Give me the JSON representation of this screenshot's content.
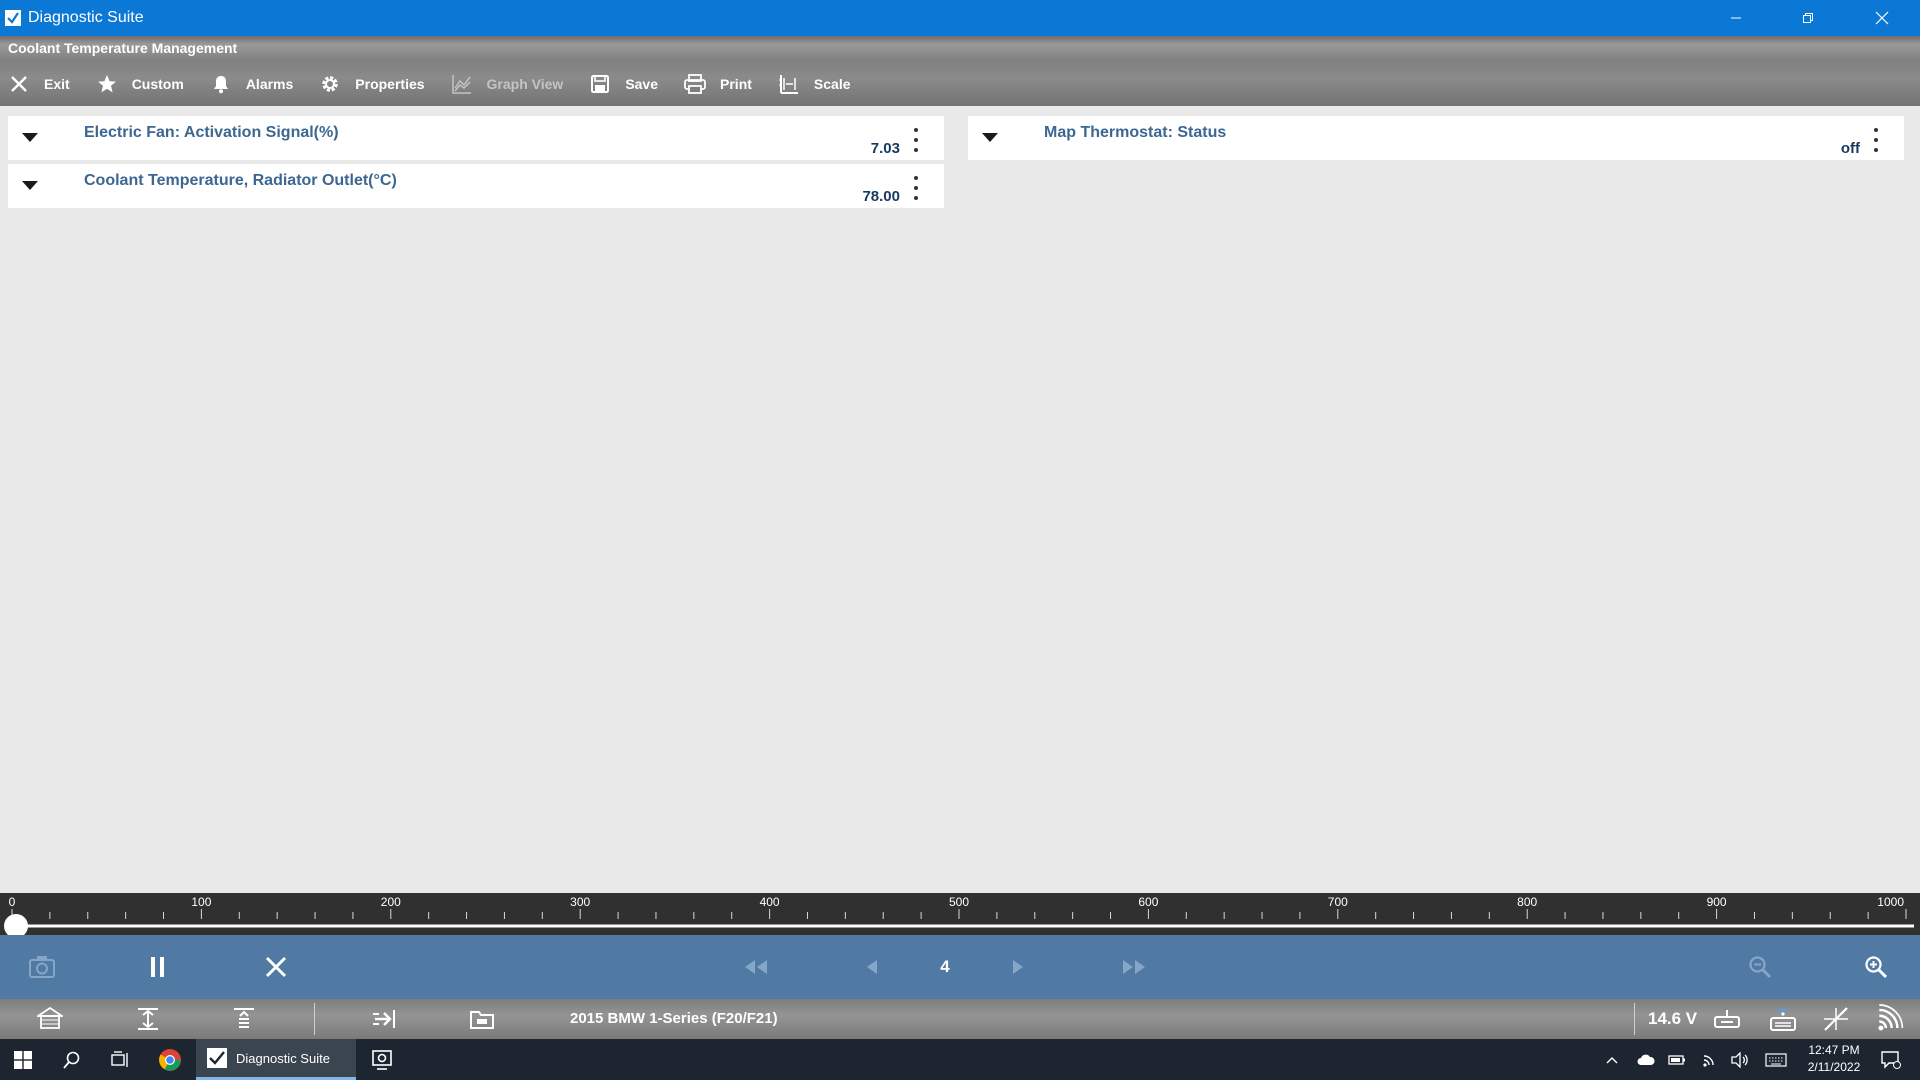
{
  "window": {
    "title": "Diagnostic Suite"
  },
  "header": {
    "module_title": "Coolant Temperature Management"
  },
  "toolbar": {
    "items": [
      {
        "label": "Exit",
        "icon": "close-icon",
        "enabled": true
      },
      {
        "label": "Custom",
        "icon": "star-icon",
        "enabled": true
      },
      {
        "label": "Alarms",
        "icon": "bell-icon",
        "enabled": true
      },
      {
        "label": "Properties",
        "icon": "gear-icon",
        "enabled": true
      },
      {
        "label": "Graph View",
        "icon": "graph-icon",
        "enabled": false
      },
      {
        "label": "Save",
        "icon": "floppy-icon",
        "enabled": true
      },
      {
        "label": "Print",
        "icon": "printer-icon",
        "enabled": true
      },
      {
        "label": "Scale",
        "icon": "scale-icon",
        "enabled": true
      }
    ]
  },
  "pids": [
    {
      "name": "Electric Fan: Activation Signal(%)",
      "value": "7.03"
    },
    {
      "name": "Coolant Temperature, Radiator Outlet(°C)",
      "value": "78.00"
    },
    {
      "name": "Map Thermostat: Status",
      "value": "off"
    }
  ],
  "timeline": {
    "labels": [
      "0",
      "100",
      "200",
      "300",
      "400",
      "500",
      "600",
      "700",
      "800",
      "900",
      "1000"
    ],
    "min": 0,
    "max": 1000,
    "position": 0
  },
  "playback": {
    "frame": "4"
  },
  "statusbar": {
    "vehicle": "2015 BMW 1-Series (F20/F21)",
    "voltage": "14.6 V"
  },
  "taskbar": {
    "active_app": "Diagnostic Suite",
    "time": "12:47 PM",
    "date": "2/11/2022"
  },
  "colors": {
    "titlebar": "#0a78d4",
    "playbar": "#5079a4",
    "pid_name": "#3b6792",
    "pid_value": "#163a5f"
  }
}
